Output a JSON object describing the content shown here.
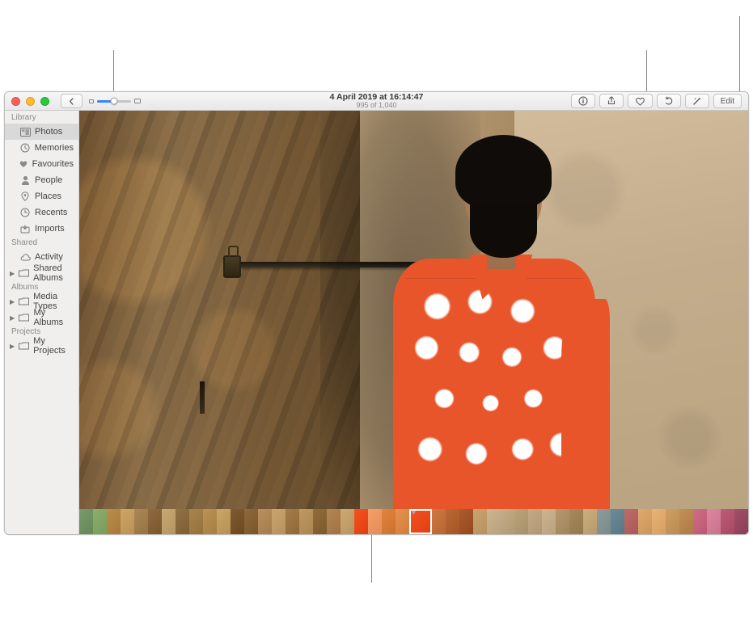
{
  "titlebar": {
    "date_title": "4 April 2019  at 16:14:47",
    "counter": "995 of 1,040",
    "edit_label": "Edit"
  },
  "sidebar": {
    "sections": {
      "library": "Library",
      "shared": "Shared",
      "albums": "Albums",
      "projects": "Projects"
    },
    "items": {
      "photos": "Photos",
      "memories": "Memories",
      "favourites": "Favourites",
      "people": "People",
      "places": "Places",
      "recents": "Recents",
      "imports": "Imports",
      "activity": "Activity",
      "shared_albums": "Shared Albums",
      "media_types": "Media Types",
      "my_albums": "My Albums",
      "my_projects": "My Projects"
    }
  },
  "filmstrip": {
    "thumbs": [
      "#7a9a6e",
      "#8fae72",
      "#b78d52",
      "#caa56d",
      "#a8875a",
      "#8b6a42",
      "#c6a978",
      "#8e7249",
      "#a68553",
      "#b7925c",
      "#c7a56e",
      "#7d5b36",
      "#8a6940",
      "#b59064",
      "#c8a574",
      "#a07c4e",
      "#bb9967",
      "#8e6c42",
      "#b0885a",
      "#cba878",
      "#e8552a",
      "#efa06f",
      "#d88648",
      "#e09257",
      "#e8552a",
      "#c87a4a",
      "#b36a3e",
      "#a45c34",
      "#c7a576",
      "#cbb595",
      "#c3ad8c",
      "#b9a380",
      "#c2ab8a",
      "#cbb595",
      "#b49873",
      "#a68a63",
      "#c9ae84",
      "#8e9c9d",
      "#6c8a95",
      "#b86e6c",
      "#d9aa73",
      "#e4b47a",
      "#caa06b",
      "#be905e",
      "#ca6e88",
      "#d788a0",
      "#b55f78",
      "#9c5168"
    ],
    "selected_index": 24
  }
}
